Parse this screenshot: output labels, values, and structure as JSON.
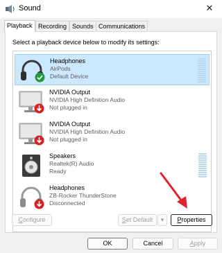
{
  "window": {
    "title": "Sound",
    "close_glyph": "✕"
  },
  "tabs": [
    {
      "label": "Playback",
      "active": true
    },
    {
      "label": "Recording",
      "active": false
    },
    {
      "label": "Sounds",
      "active": false
    },
    {
      "label": "Communications",
      "active": false
    }
  ],
  "instruction": "Select a playback device below to modify its settings:",
  "devices": [
    {
      "name": "Headphones",
      "line2": "AirPods",
      "line3": "Default Device",
      "icon": "headphones-icon",
      "status_badge": "check-badge-icon",
      "selected": true
    },
    {
      "name": "NVIDIA Output",
      "line2": "NVIDIA High Definition Audio",
      "line3": "Not plugged in",
      "icon": "monitor-icon",
      "status_badge": "unplugged-badge-icon",
      "selected": false
    },
    {
      "name": "NVIDIA Output",
      "line2": "NVIDIA High Definition Audio",
      "line3": "Not plugged in",
      "icon": "monitor-icon",
      "status_badge": "unplugged-badge-icon",
      "selected": false
    },
    {
      "name": "Speakers",
      "line2": "Realtek(R) Audio",
      "line3": "Ready",
      "icon": "speaker-icon",
      "status_badge": "",
      "selected": false
    },
    {
      "name": "Headphones",
      "line2": "ZB-Rocker ThunderStone",
      "line3": "Disconnected",
      "icon": "headphones-icon",
      "status_badge": "unplugged-badge-icon",
      "selected": false
    }
  ],
  "buttons": {
    "configure": {
      "first": "C",
      "rest": "onfigure",
      "enabled": false
    },
    "set_default": {
      "first": "S",
      "rest": "et Default",
      "enabled": false
    },
    "set_default_dropdown": {
      "glyph": "▾",
      "enabled": false
    },
    "properties": {
      "first": "P",
      "rest": "roperties",
      "enabled": true
    },
    "ok": {
      "label": "OK",
      "enabled": true
    },
    "cancel": {
      "label": "Cancel",
      "enabled": true
    },
    "apply": {
      "first": "A",
      "rest": "pply",
      "enabled": false
    }
  },
  "colors": {
    "accent_selected": "#cce8ff",
    "annotation_arrow": "#e0242b",
    "check_green": "#1e9a3c",
    "unplugged_red": "#d42323"
  }
}
